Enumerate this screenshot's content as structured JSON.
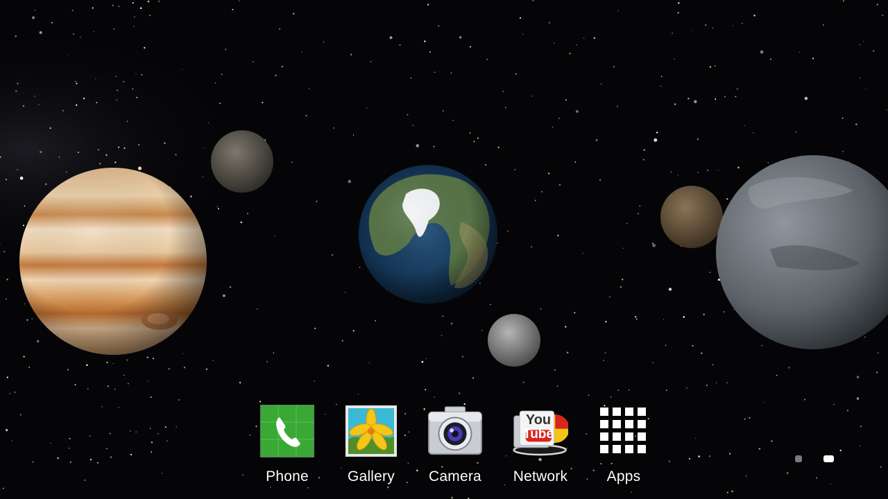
{
  "wallpaper": {
    "planets": [
      {
        "name": "jupiter-planet"
      },
      {
        "name": "earth-planet"
      },
      {
        "name": "moon-gray"
      },
      {
        "name": "moon-dark"
      },
      {
        "name": "moon-brown"
      },
      {
        "name": "moon-small"
      }
    ]
  },
  "dock": {
    "apps": [
      {
        "id": "phone",
        "label": "Phone",
        "icon": "phone-icon",
        "color": "#3aa835"
      },
      {
        "id": "gallery",
        "label": "Gallery",
        "icon": "gallery-icon",
        "color": "#f2c21b"
      },
      {
        "id": "camera",
        "label": "Camera",
        "icon": "camera-icon",
        "color": "#c9ccd2"
      },
      {
        "id": "network",
        "label": "Network",
        "icon": "network-folder-icon",
        "color": "#d8261e"
      },
      {
        "id": "apps",
        "label": "Apps",
        "icon": "apps-grid-icon",
        "color": "#ffffff"
      }
    ]
  },
  "youtube_logo": {
    "top": "You",
    "bottom": "Tube"
  },
  "page_indicator": {
    "pages": 2,
    "current": 2
  }
}
